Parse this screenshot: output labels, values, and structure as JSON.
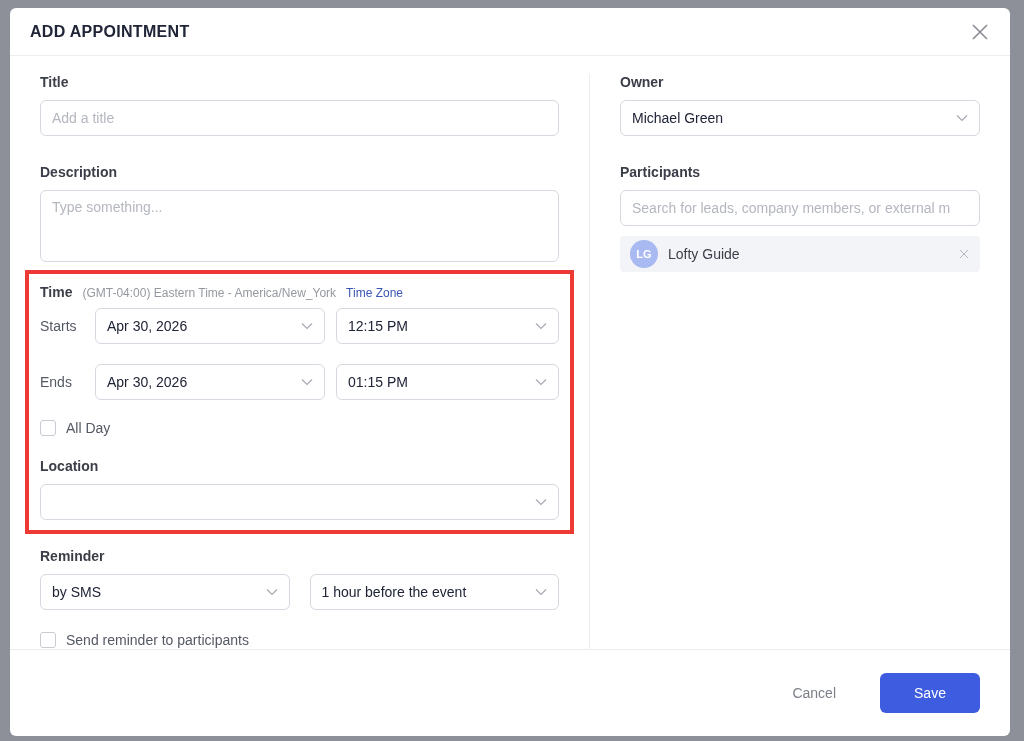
{
  "dialog": {
    "title": "ADD APPOINTMENT",
    "title_field": {
      "label": "Title",
      "placeholder": "Add a title"
    },
    "description": {
      "label": "Description",
      "placeholder": "Type something..."
    },
    "time": {
      "label": "Time",
      "timezone": "(GMT-04:00) Eastern Time - America/New_York",
      "timezone_link": "Time Zone",
      "highlighted": true,
      "rows": [
        {
          "label": "Starts",
          "date": "Apr 30, 2026",
          "time": "12:15 PM"
        },
        {
          "label": "Ends",
          "date": "Apr 30, 2026",
          "time": "01:15 PM"
        }
      ],
      "all_day": {
        "label": "All Day",
        "checked": false
      }
    },
    "location": {
      "label": "Location"
    },
    "reminder": {
      "label": "Reminder",
      "method": "by SMS",
      "when": "1 hour before the event",
      "send_to_participants": {
        "label": "Send reminder to participants",
        "checked": false
      }
    },
    "owner": {
      "label": "Owner",
      "value": "Michael Green"
    },
    "participants": {
      "label": "Participants",
      "placeholder": "Search for leads, company members, or external m",
      "items": [
        {
          "initials": "LG",
          "name": "Lofty Guide"
        }
      ]
    },
    "buttons": {
      "cancel": "Cancel",
      "save": "Save"
    }
  }
}
